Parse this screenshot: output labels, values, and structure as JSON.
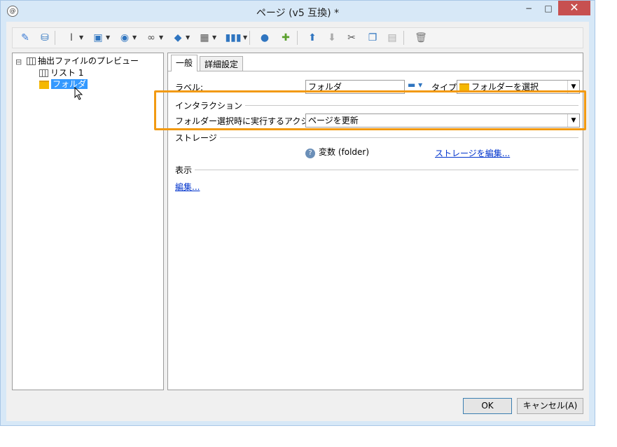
{
  "window": {
    "title": "ページ (v5 互換) *",
    "minimize_glyph": "−",
    "maximize_glyph": "□",
    "close_glyph": "✕",
    "app_icon_glyph": "@"
  },
  "toolbar": {
    "items": [
      {
        "icon": "magic-wand-icon",
        "glyph": "✎",
        "color": "#3a7bd5"
      },
      {
        "icon": "database-icon",
        "glyph": "⛁",
        "color": "#2f75c0"
      },
      {
        "icon": "text-cursor-icon",
        "glyph": "Ⅰ",
        "color": "#555555"
      },
      {
        "icon": "insert-field-icon",
        "glyph": "▣",
        "color": "#2f75c0"
      },
      {
        "icon": "globe-icon",
        "glyph": "◉",
        "color": "#2f75c0"
      },
      {
        "icon": "link-icon",
        "glyph": "∞",
        "color": "#555555"
      },
      {
        "icon": "layers-icon",
        "glyph": "◆",
        "color": "#2f75c0"
      },
      {
        "icon": "table-icon",
        "glyph": "▦",
        "color": "#555555"
      },
      {
        "icon": "columns-icon",
        "glyph": "▮▮▮",
        "color": "#2f75c0"
      },
      {
        "icon": "user-icon",
        "glyph": "●",
        "color": "#2f75c0"
      },
      {
        "icon": "add-element-icon",
        "glyph": "✚",
        "color": "#5aa02c"
      },
      {
        "icon": "move-up-icon",
        "glyph": "⬆",
        "color": "#2f75c0"
      },
      {
        "icon": "move-down-icon",
        "glyph": "⬇",
        "color": "#aaaaaa"
      },
      {
        "icon": "cut-icon",
        "glyph": "✂",
        "color": "#555555"
      },
      {
        "icon": "copy-icon",
        "glyph": "❐",
        "color": "#2f75c0"
      },
      {
        "icon": "paste-icon",
        "glyph": "▤",
        "color": "#aaaaaa"
      },
      {
        "icon": "delete-icon",
        "glyph": "🗑",
        "color": "#777777"
      }
    ]
  },
  "tree": {
    "collapse_glyph": "⊟",
    "root": "抽出ファイルのプレビュー",
    "children": [
      "リスト 1",
      "フォルダ"
    ]
  },
  "tabs": [
    "一般",
    "詳細設定"
  ],
  "general": {
    "label_caption": "ラベル:",
    "label_value": "フォルダ",
    "type_caption": "タイプ:",
    "type_value": "フォルダーを選択",
    "interaction_header": "インタラクション",
    "action_caption": "フォルダー選択時に実行するアクション:",
    "action_value": "ページを更新",
    "storage_header": "ストレージ",
    "storage_info": "変数 (folder)",
    "storage_edit_link": "ストレージを編集...",
    "display_header": "表示",
    "display_edit_link": "編集..."
  },
  "buttons": {
    "ok": "OK",
    "cancel": "キャンセル(A)"
  },
  "colors": {
    "highlight": "#f29a12",
    "link": "#0033cc",
    "selection": "#3399ff"
  }
}
